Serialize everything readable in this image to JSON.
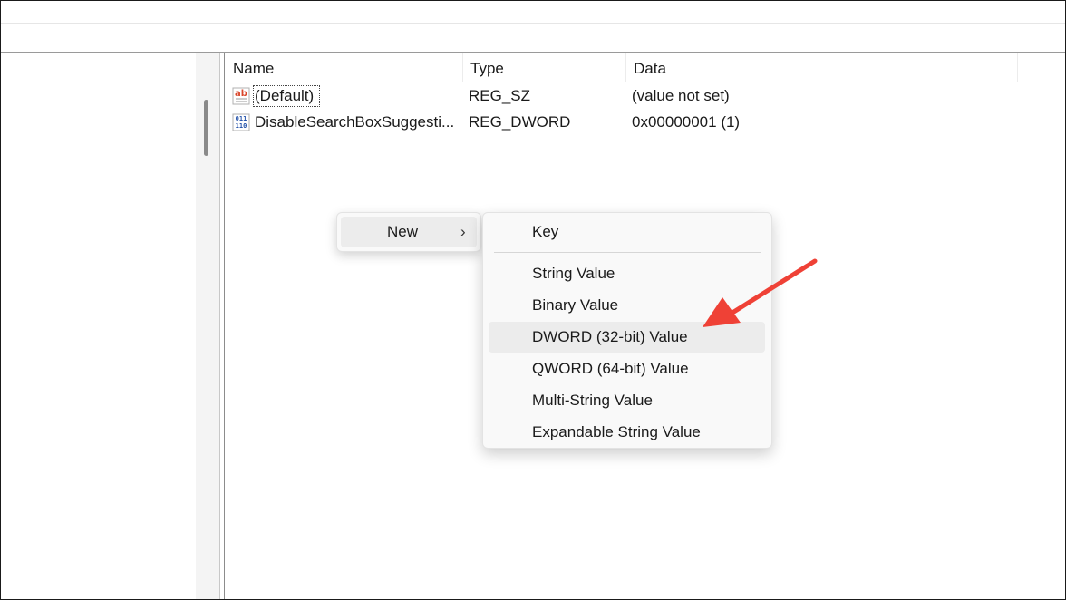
{
  "columns": {
    "name": "Name",
    "type": "Type",
    "data": "Data"
  },
  "rows": [
    {
      "icon": "string-value-icon",
      "icon_text": "ab",
      "name": "(Default)",
      "type": "REG_SZ",
      "data": "(value not set)"
    },
    {
      "icon": "binary-value-icon",
      "icon_text": "011 110",
      "name": "DisableSearchBoxSuggesti...",
      "type": "REG_DWORD",
      "data": "0x00000001 (1)"
    }
  ],
  "context_menu": {
    "new_label": "New",
    "chevron": "›"
  },
  "submenu": {
    "items": [
      "Key",
      "String Value",
      "Binary Value",
      "DWORD (32-bit) Value",
      "QWORD (64-bit) Value",
      "Multi-String Value",
      "Expandable String Value"
    ],
    "highlighted_index": 3
  },
  "colors": {
    "annotation_arrow": "#ef4136",
    "menu_highlight": "#ececec",
    "string_icon": "#d9462b",
    "binary_icon": "#1f4fa8"
  }
}
